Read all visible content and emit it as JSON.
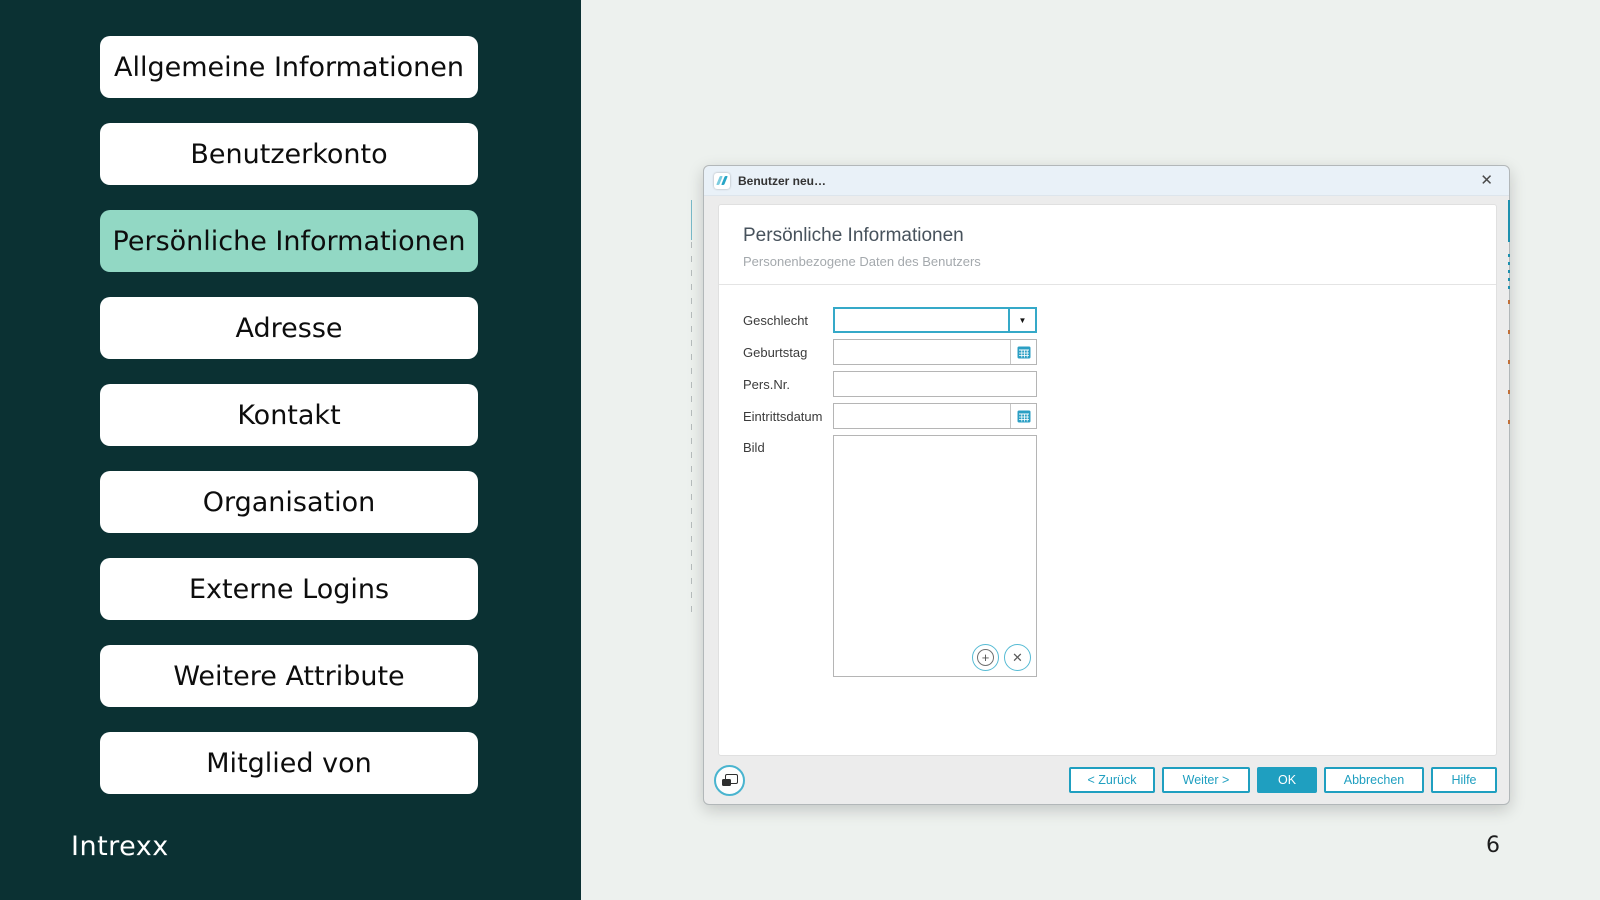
{
  "slide": {
    "logo_text": "Intrexx",
    "page_number": "6"
  },
  "sidebar": {
    "items": [
      {
        "label": "Allgemeine Informationen",
        "active": false
      },
      {
        "label": "Benutzerkonto",
        "active": false
      },
      {
        "label": "Persönliche Informationen",
        "active": true
      },
      {
        "label": "Adresse",
        "active": false
      },
      {
        "label": "Kontakt",
        "active": false
      },
      {
        "label": "Organisation",
        "active": false
      },
      {
        "label": "Externe Logins",
        "active": false
      },
      {
        "label": "Weitere Attribute",
        "active": false
      },
      {
        "label": "Mitglied von",
        "active": false
      }
    ]
  },
  "dialog": {
    "title": "Benutzer neu…",
    "icons": {
      "app_logo": "intrexx-double-slash",
      "close": "✕",
      "dropdown_arrow": "▼",
      "calendar": "calendar-grid",
      "add": "+",
      "remove": "✕",
      "preview": "overlapping-windows"
    },
    "header": {
      "title": "Persönliche Informationen",
      "subtitle": "Personenbezogene Daten des Benutzers"
    },
    "form": {
      "fields": [
        {
          "label": "Geschlecht",
          "type": "dropdown",
          "value": "",
          "focused": true
        },
        {
          "label": "Geburtstag",
          "type": "date",
          "value": "",
          "focused": false
        },
        {
          "label": "Pers.Nr.",
          "type": "text",
          "value": "",
          "focused": false
        },
        {
          "label": "Eintrittsdatum",
          "type": "date",
          "value": "",
          "focused": false
        },
        {
          "label": "Bild",
          "type": "image",
          "value": "",
          "focused": false
        }
      ]
    },
    "footer": {
      "buttons": [
        {
          "label": "< Zurück",
          "style": "outline"
        },
        {
          "label": "Weiter >",
          "style": "outline"
        },
        {
          "label": "OK",
          "style": "primary"
        },
        {
          "label": "Abbrechen",
          "style": "outline"
        },
        {
          "label": "Hilfe",
          "style": "outline"
        }
      ]
    }
  },
  "colors": {
    "sidebar_bg": "#0b3133",
    "active_item_bg": "#92d8c4",
    "slide_bg": "#edf1ee",
    "accent_teal": "#1f9fc0",
    "focus_border": "#35a9c8",
    "titlebar_bg": "#e9f1f8",
    "dialog_bg": "#ececec"
  }
}
